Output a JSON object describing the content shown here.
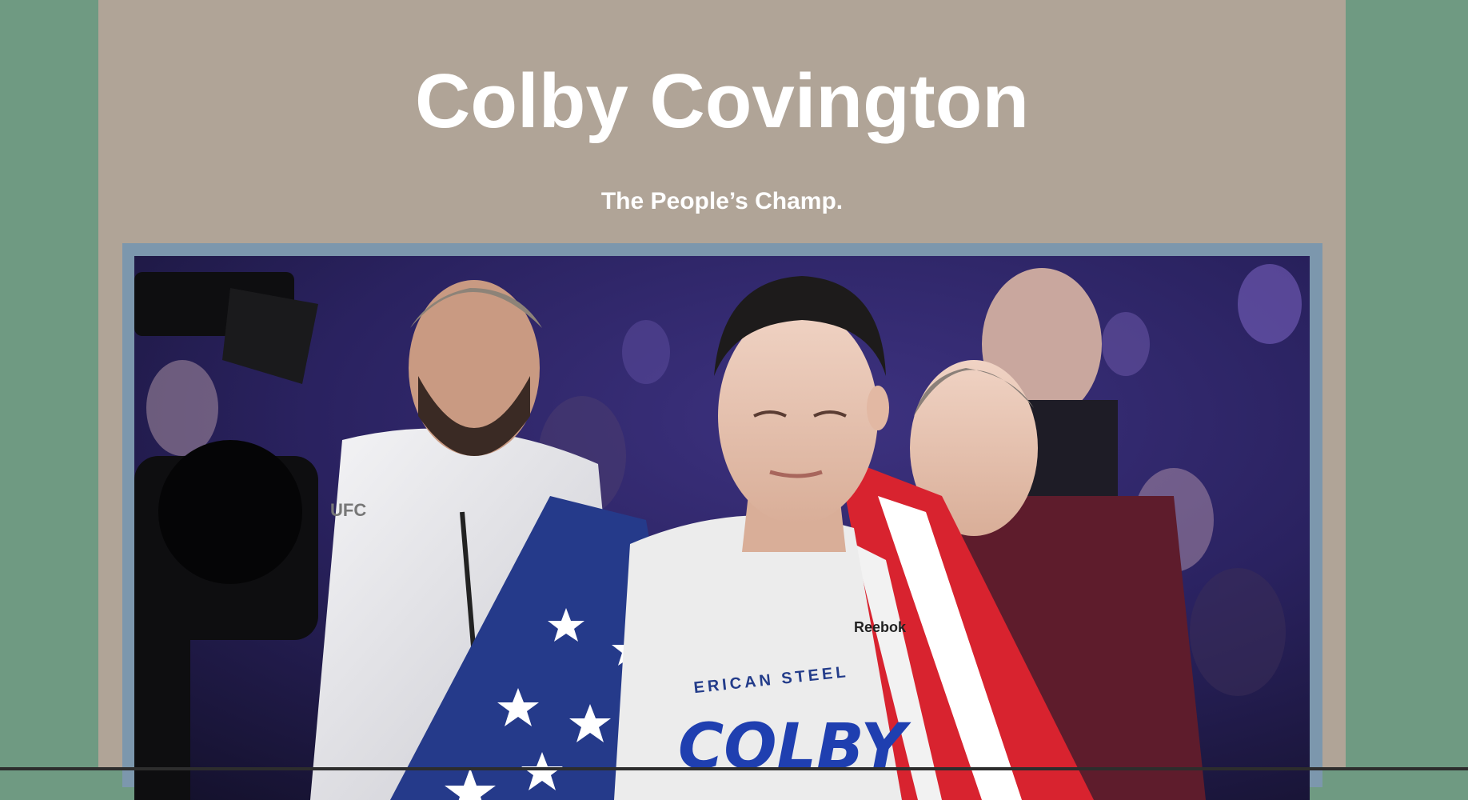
{
  "page": {
    "title": "Colby Covington",
    "subtitle": "The People’s Champ."
  },
  "hero_image": {
    "subject": "fighter-walkout-photo",
    "shirt_text_top": "ERICAN STEEL",
    "shirt_text_main": "COLBY",
    "hoodie_logo": "UFC",
    "brand_logo": "Reebok"
  },
  "colors": {
    "background": "#6f9a82",
    "content_panel": "#b0a497",
    "photo_border": "#7c97ad",
    "heading_text": "#ffffff"
  }
}
